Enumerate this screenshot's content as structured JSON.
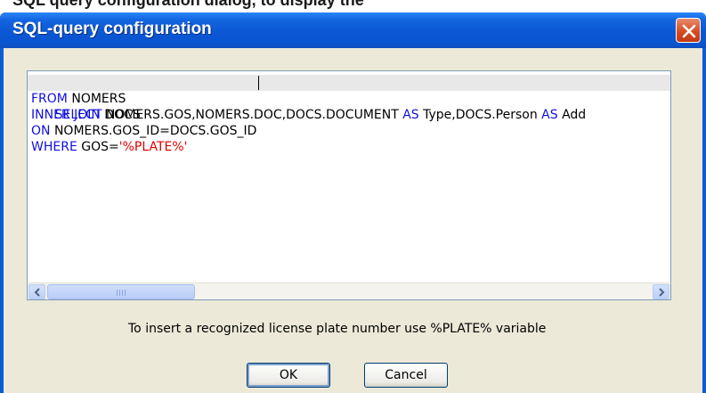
{
  "background": {
    "partial_title_text": "SQL query configuration dialog, to display the"
  },
  "dialog": {
    "title": "SQL-query configuration",
    "close_icon": "close-x-icon",
    "editor": {
      "lines": [
        [
          {
            "text": "SELECT",
            "kind": "kw"
          },
          {
            "text": " NOMERS.GOS,NOMERS.DOC,",
            "kind": "plain"
          },
          {
            "text": "DOCS.DOCUMENT ",
            "kind": "plain"
          },
          {
            "text": "AS",
            "kind": "kw"
          },
          {
            "text": " Type,DOCS.Person ",
            "kind": "plain"
          },
          {
            "text": "AS",
            "kind": "kw"
          },
          {
            "text": " Add",
            "kind": "plain"
          }
        ],
        [
          {
            "text": "FROM",
            "kind": "kw"
          },
          {
            "text": " NOMERS",
            "kind": "plain"
          }
        ],
        [
          {
            "text": "INNER JOIN",
            "kind": "kw"
          },
          {
            "text": " DOCS",
            "kind": "plain"
          }
        ],
        [
          {
            "text": "ON",
            "kind": "kw"
          },
          {
            "text": " NOMERS.GOS_ID=DOCS.GOS_ID",
            "kind": "plain"
          }
        ],
        [
          {
            "text": "WHERE",
            "kind": "kw"
          },
          {
            "text": " GOS=",
            "kind": "plain"
          },
          {
            "text": "'%PLATE%'",
            "kind": "str"
          }
        ]
      ]
    },
    "scrollbar": {
      "left_arrow_icon": "scroll-left-arrow-icon",
      "right_arrow_icon": "scroll-right-arrow-icon",
      "thumb_grip_icon": "scroll-grip-icon"
    },
    "hint": "To insert a recognized license plate number use %PLATE% variable",
    "buttons": {
      "ok": "OK",
      "cancel": "Cancel"
    },
    "colors": {
      "keyword": "#1010e0",
      "string": "#e00000",
      "title_bar": "#0a55d0",
      "close_button": "#d4491f",
      "dialog_face": "#ece9d8"
    }
  }
}
